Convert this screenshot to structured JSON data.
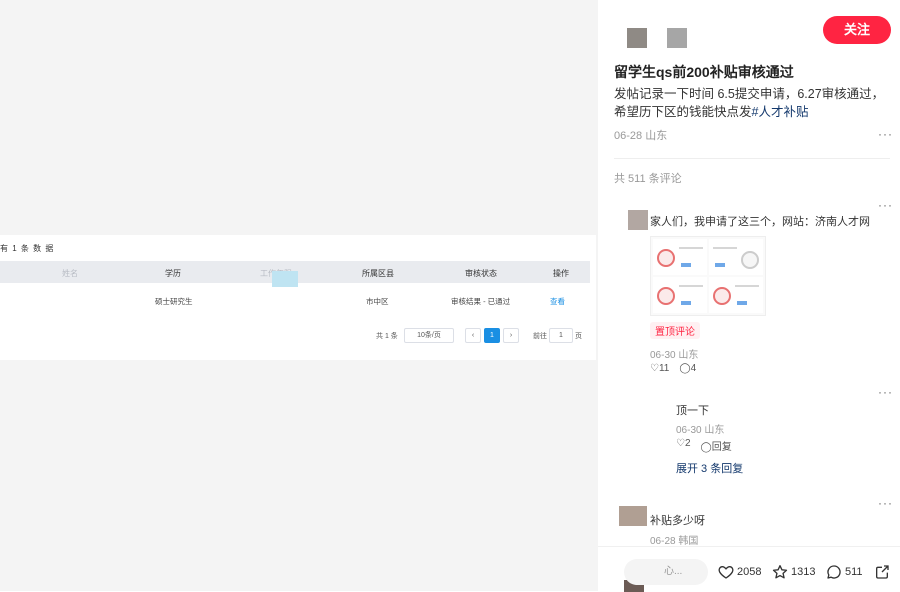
{
  "media": {
    "count_text": "有 1 条 数 据",
    "table_headers": [
      "姓名",
      "学历",
      "工作年限",
      "所属区县",
      "审核状态",
      "操作"
    ],
    "row": {
      "degree": "硕士研究生",
      "district": "市中区",
      "status": "审核结果 - 已通过",
      "action": "查看"
    },
    "pager": {
      "total": "共 1 条",
      "size": "10条/页",
      "prev": "‹",
      "page": "1",
      "next": "›",
      "goto": "前往",
      "goto_value": "1",
      "page_unit": "页"
    }
  },
  "post": {
    "follow_label": "关注",
    "title": "留学生qs前200补贴审核通过",
    "body": "发帖记录一下时间 6.5提交申请，6.27审核通过，希望历下区的钱能快点发",
    "tag": "#人才补贴",
    "date_location": "06-28 山东",
    "more": "···"
  },
  "comments": {
    "count_text": "共 511 条评论",
    "items": [
      {
        "text": "家人们，我申请了这三个，网站：济南人才网",
        "badge": "置顶评论",
        "meta": "06-30 山东",
        "likes": "11",
        "replies": "4"
      }
    ],
    "reply": {
      "text": "顶一下",
      "meta": "06-30 山东",
      "likes": "2",
      "reply_label": "回复"
    },
    "expand": "展开 3 条回复",
    "second": {
      "text": "补贴多少呀",
      "meta": "06-28 韩国"
    }
  },
  "bottom": {
    "input_placeholder": "心...",
    "likes": "2058",
    "stars": "1313",
    "comments": "511"
  },
  "colors": {
    "accent": "#ff2442",
    "link": "#13386c",
    "table_blue": "#1a8fe3"
  }
}
